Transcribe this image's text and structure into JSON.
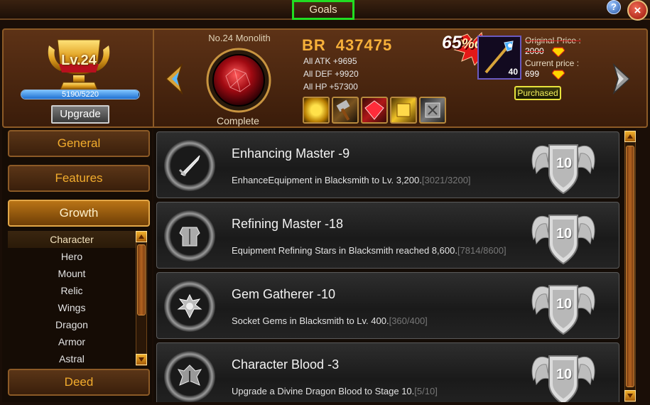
{
  "window": {
    "title": "Goals",
    "help_label": "?",
    "close_label": "×"
  },
  "level_panel": {
    "level_label": "Lv.24",
    "xp_text": "5190/5220",
    "xp_progress": 0.994,
    "upgrade_label": "Upgrade"
  },
  "monolith": {
    "name": "No.24 Monolith",
    "status": "Complete"
  },
  "stats": {
    "br_label": "BR",
    "br_value": "437475",
    "atk": "All ATK +9695",
    "def": "All DEF +9920",
    "hp": "All HP +57300"
  },
  "rewards": [
    {
      "icon": "gold-coin-icon"
    },
    {
      "icon": "hammer-icon"
    },
    {
      "icon": "ruby-gem-icon"
    },
    {
      "icon": "gold-block-icon"
    },
    {
      "icon": "steel-box-icon"
    }
  ],
  "offer": {
    "discount": "65",
    "discount_suffix": "%off",
    "item_count": "40",
    "original_price_label": "Original Price :",
    "original_price": "2000",
    "current_price_label": "Current price :",
    "current_price": "699",
    "purchased_label": "Purchased"
  },
  "sidebar": {
    "categories": [
      {
        "label": "General",
        "active": false
      },
      {
        "label": "Features",
        "active": false
      },
      {
        "label": "Growth",
        "active": true
      },
      {
        "label": "Deed",
        "active": false
      }
    ],
    "sub_items": [
      {
        "label": "Character",
        "active": true
      },
      {
        "label": "Hero",
        "active": false
      },
      {
        "label": "Mount",
        "active": false
      },
      {
        "label": "Relic",
        "active": false
      },
      {
        "label": "Wings",
        "active": false
      },
      {
        "label": "Dragon",
        "active": false
      },
      {
        "label": "Armor",
        "active": false
      },
      {
        "label": "Astral",
        "active": false
      }
    ]
  },
  "goals": [
    {
      "title": "Enhancing Master -9",
      "description": "EnhanceEquipment in Blacksmith to Lv. 3,200.",
      "progress": "[3021/3200]",
      "medal_value": "10",
      "icon": "sword-icon"
    },
    {
      "title": "Refining Master -18",
      "description": "Equipment Refining Stars in Blacksmith reached 8,600.",
      "progress": "[7814/8600]",
      "medal_value": "10",
      "icon": "armor-icon"
    },
    {
      "title": "Gem Gatherer -10",
      "description": "Socket Gems in Blacksmith to Lv. 400.",
      "progress": "[360/400]",
      "medal_value": "10",
      "icon": "gem-crest-icon"
    },
    {
      "title": "Character Blood -3",
      "description": "Upgrade a Divine Dragon Blood to Stage 10.",
      "progress": "[5/10]",
      "medal_value": "10",
      "icon": "dragon-crest-icon"
    }
  ]
}
